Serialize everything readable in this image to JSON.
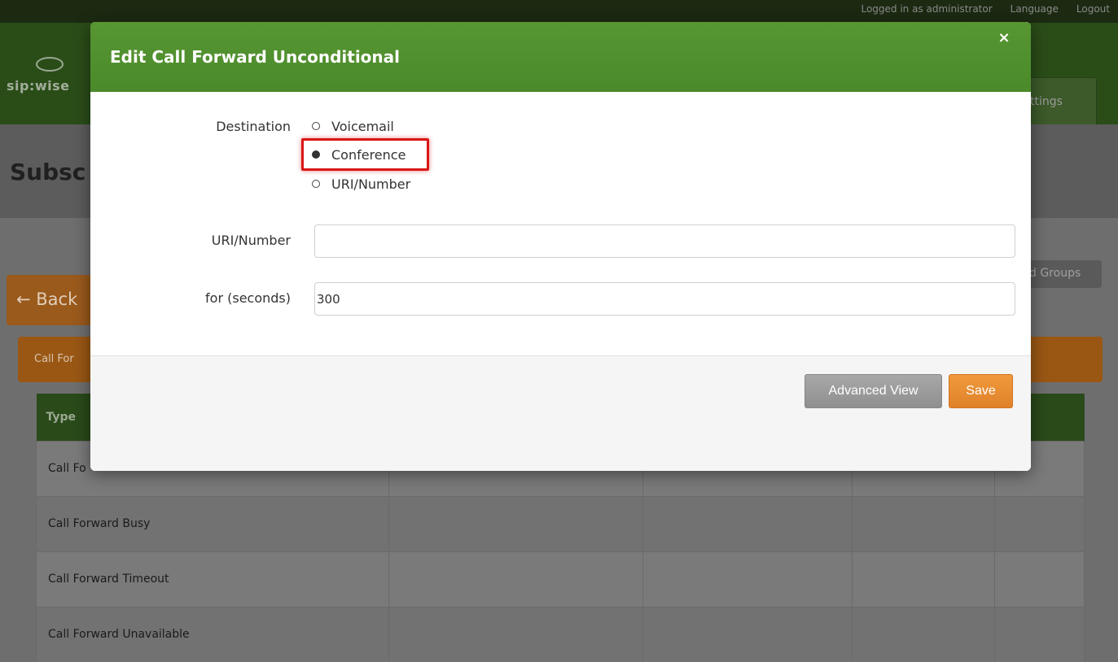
{
  "topbar": {
    "user": "Logged in as administrator",
    "language": "Language",
    "logout": "Logout"
  },
  "navbar": {
    "logo_text": "sip:wise",
    "settings": "ttings"
  },
  "page": {
    "title": "Subsc",
    "back": "← Back",
    "groups_button": "d Groups",
    "panel_header": "Call For"
  },
  "table": {
    "header_type": "Type",
    "rows": [
      "Call Fo",
      "Call Forward Busy",
      "Call Forward Timeout",
      "Call Forward Unavailable"
    ]
  },
  "modal": {
    "title": "Edit Call Forward Unconditional",
    "close": "×",
    "destination_label": "Destination",
    "options": {
      "voicemail": "Voicemail",
      "conference": "Conference",
      "uri_number": "URI/Number"
    },
    "selected_option": "Conference",
    "uri_label": "URI/Number",
    "uri_value": "",
    "seconds_label": "for (seconds)",
    "seconds_value": "300",
    "advanced_button": "Advanced View",
    "save_button": "Save"
  }
}
